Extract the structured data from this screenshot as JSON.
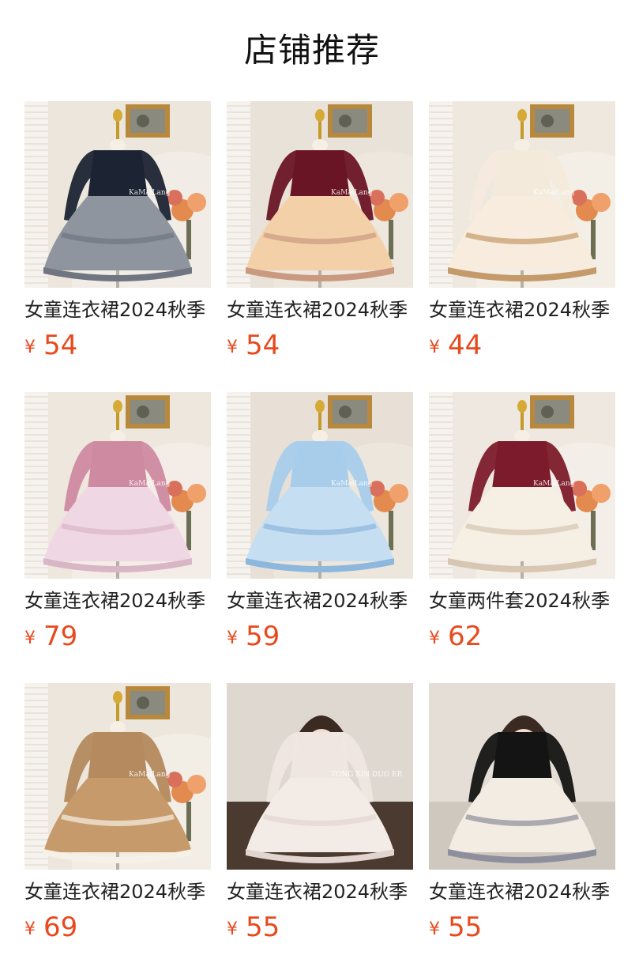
{
  "page": {
    "title": "店铺推荐"
  },
  "currency_symbol": "¥",
  "products": [
    {
      "name": "女童连衣裙2024秋季",
      "price": "54",
      "bg": "#ece6dc",
      "dress_top": "#1c2433",
      "dress_skirt": "#8f959e",
      "trim": "#6f7682",
      "stand_bg": "#f3efe8",
      "brand": "KaMaiLang"
    },
    {
      "name": "女童连衣裙2024秋季",
      "price": "54",
      "bg": "#e9e2d8",
      "dress_top": "#6a1526",
      "dress_skirt": "#f4d0a8",
      "trim": "#c99a80",
      "stand_bg": "#efe8de",
      "brand": "KaMaiLang"
    },
    {
      "name": "女童连衣裙2024秋季",
      "price": "44",
      "bg": "#eee8df",
      "dress_top": "#f4eadc",
      "dress_skirt": "#f7ecdd",
      "trim": "#c59a6a",
      "stand_bg": "#f4efe7",
      "brand": "KaMaiLang"
    },
    {
      "name": "女童连衣裙2024秋季",
      "price": "79",
      "bg": "#eee7de",
      "dress_top": "#cd8aa0",
      "dress_skirt": "#f0d7e4",
      "trim": "#d8b6c6",
      "stand_bg": "#f4eee8",
      "brand": "KaMaiLang"
    },
    {
      "name": "女童连衣裙2024秋季",
      "price": "59",
      "bg": "#e8e0d6",
      "dress_top": "#a8cdeb",
      "dress_skirt": "#c6def2",
      "trim": "#8db7dc",
      "stand_bg": "#eee7dd",
      "brand": "KaMaiLang"
    },
    {
      "name": "女童两件套2024秋季",
      "price": "62",
      "bg": "#eee8e0",
      "dress_top": "#7c1b2b",
      "dress_skirt": "#f6efe4",
      "trim": "#d7c6b2",
      "stand_bg": "#f4efe8",
      "brand": "KaMaiLang"
    },
    {
      "name": "女童连衣裙2024秋季",
      "price": "69",
      "bg": "#ece6dc",
      "dress_top": "#b48a5e",
      "dress_skirt": "#c69a6a",
      "trim": "#f7f0e6",
      "stand_bg": "#f4efe7",
      "brand": "KaMaiLang"
    },
    {
      "name": "女童连衣裙2024秋季",
      "price": "55",
      "bg": "#ded8d0",
      "dress_top": "#efe6e2",
      "dress_skirt": "#f3ebe6",
      "trim": "#e2d5d0",
      "stand_bg": "#4a3a30",
      "brand": "TONG XIN DUO ER"
    },
    {
      "name": "女童连衣裙2024秋季",
      "price": "55",
      "bg": "#e4ded6",
      "dress_top": "#141414",
      "dress_skirt": "#f3ece2",
      "trim": "#8d8f9d",
      "stand_bg": "#cfc8bf",
      "brand": ""
    }
  ]
}
